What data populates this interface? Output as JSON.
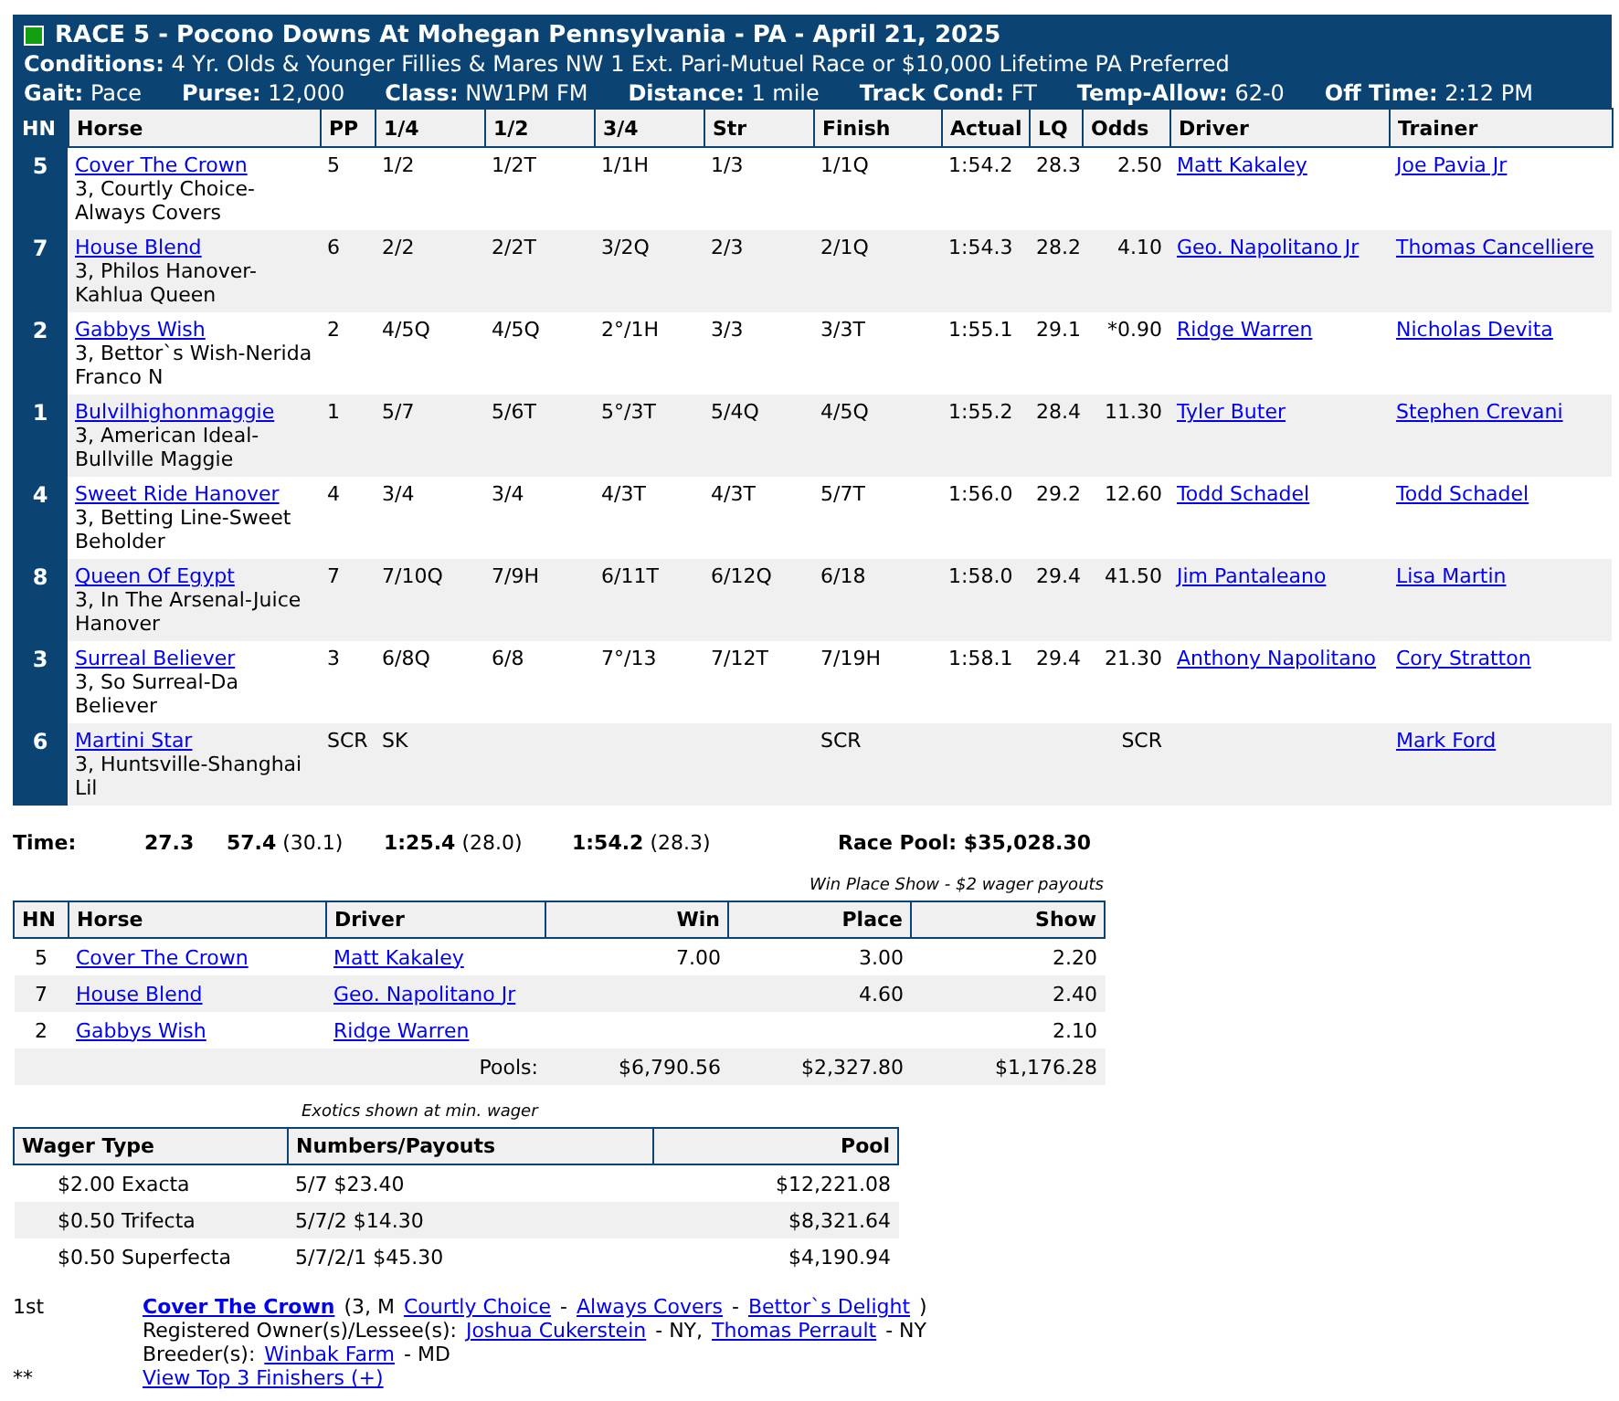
{
  "header": {
    "title": "RACE 5 - Pocono Downs At Mohegan Pennsylvania - PA - April 21, 2025",
    "conditions": {
      "label": "Conditions:",
      "value": "4 Yr. Olds & Younger Fillies & Mares NW 1 Ext. Pari-Mutuel Race or $10,000 Lifetime PA Preferred"
    },
    "info": [
      {
        "label": "Gait:",
        "value": "Pace"
      },
      {
        "label": "Purse:",
        "value": "12,000"
      },
      {
        "label": "Class:",
        "value": "NW1PM FM"
      },
      {
        "label": "Distance:",
        "value": "1 mile"
      },
      {
        "label": "Track Cond:",
        "value": "FT"
      },
      {
        "label": "Temp-Allow:",
        "value": "62-0"
      },
      {
        "label": "Off Time:",
        "value": "2:12 PM"
      }
    ]
  },
  "results": {
    "columns": [
      "HN",
      "Horse",
      "PP",
      "1/4",
      "1/2",
      "3/4",
      "Str",
      "Finish",
      "Actual",
      "LQ",
      "Odds",
      "Driver",
      "Trainer"
    ],
    "rows": [
      {
        "hn": "5",
        "horse": "Cover The Crown",
        "pedigree": "3, Courtly Choice-Always Covers",
        "pp": "5",
        "q1": "1/2",
        "q2": "1/2T",
        "q3": "1/1H",
        "str": "1/3",
        "finish": "1/1Q",
        "actual": "1:54.2",
        "lq": "28.3",
        "odds": "2.50",
        "driver": "Matt Kakaley",
        "trainer": "Joe Pavia Jr"
      },
      {
        "hn": "7",
        "horse": "House Blend",
        "pedigree": "3, Philos Hanover-Kahlua Queen",
        "pp": "6",
        "q1": "2/2",
        "q2": "2/2T",
        "q3": "3/2Q",
        "str": "2/3",
        "finish": "2/1Q",
        "actual": "1:54.3",
        "lq": "28.2",
        "odds": "4.10",
        "driver": "Geo. Napolitano Jr",
        "trainer": "Thomas Cancelliere"
      },
      {
        "hn": "2",
        "horse": "Gabbys Wish",
        "pedigree": "3, Bettor`s Wish-Nerida Franco N",
        "pp": "2",
        "q1": "4/5Q",
        "q2": "4/5Q",
        "q3": "2°/1H",
        "str": "3/3",
        "finish": "3/3T",
        "actual": "1:55.1",
        "lq": "29.1",
        "odds": "*0.90",
        "driver": "Ridge Warren",
        "trainer": "Nicholas Devita"
      },
      {
        "hn": "1",
        "horse": "Bulvilhighonmaggie",
        "pedigree": "3, American Ideal-Bullville Maggie",
        "pp": "1",
        "q1": "5/7",
        "q2": "5/6T",
        "q3": "5°/3T",
        "str": "5/4Q",
        "finish": "4/5Q",
        "actual": "1:55.2",
        "lq": "28.4",
        "odds": "11.30",
        "driver": "Tyler Buter",
        "trainer": "Stephen Crevani"
      },
      {
        "hn": "4",
        "horse": "Sweet Ride Hanover",
        "pedigree": "3, Betting Line-Sweet Beholder",
        "pp": "4",
        "q1": "3/4",
        "q2": "3/4",
        "q3": "4/3T",
        "str": "4/3T",
        "finish": "5/7T",
        "actual": "1:56.0",
        "lq": "29.2",
        "odds": "12.60",
        "driver": "Todd Schadel",
        "trainer": "Todd Schadel"
      },
      {
        "hn": "8",
        "horse": "Queen Of Egypt",
        "pedigree": "3, In The Arsenal-Juice Hanover",
        "pp": "7",
        "q1": "7/10Q",
        "q2": "7/9H",
        "q3": "6/11T",
        "str": "6/12Q",
        "finish": "6/18",
        "actual": "1:58.0",
        "lq": "29.4",
        "odds": "41.50",
        "driver": "Jim Pantaleano",
        "trainer": "Lisa Martin"
      },
      {
        "hn": "3",
        "horse": "Surreal Believer",
        "pedigree": "3, So Surreal-Da Believer",
        "pp": "3",
        "q1": "6/8Q",
        "q2": "6/8",
        "q3": "7°/13",
        "str": "7/12T",
        "finish": "7/19H",
        "actual": "1:58.1",
        "lq": "29.4",
        "odds": "21.30",
        "driver": "Anthony Napolitano",
        "trainer": "Cory Stratton"
      },
      {
        "hn": "6",
        "horse": "Martini Star",
        "pedigree": "3, Huntsville-Shanghai Lil",
        "pp": "SCR",
        "q1": "SK",
        "finish": "SCR",
        "odds": "SCR",
        "trainer": "Mark Ford"
      }
    ]
  },
  "times": {
    "label": "Time:",
    "splits": [
      "**27.3**",
      "**57.4** (30.1)",
      "**1:25.4** (28.0)",
      "**1:54.2** (28.3)"
    ]
  },
  "race_pool": "Race Pool: $35,028.30",
  "wps": {
    "caption": "Win Place Show - $2 wager payouts",
    "columns": [
      "HN",
      "Horse",
      "Driver",
      "Win",
      "Place",
      "Show"
    ],
    "rows": [
      {
        "hn": "5",
        "horse": "Cover The Crown",
        "driver": "Matt Kakaley",
        "win": "7.00",
        "place": "3.00",
        "show": "2.20"
      },
      {
        "hn": "7",
        "horse": "House Blend",
        "driver": "Geo. Napolitano Jr",
        "place": "4.60",
        "show": "2.40"
      },
      {
        "hn": "2",
        "horse": "Gabbys Wish",
        "driver": "Ridge Warren",
        "show": "2.10"
      }
    ],
    "pools": {
      "label": "Pools:",
      "win": "$6,790.56",
      "place": "$2,327.80",
      "show": "$1,176.28"
    }
  },
  "exotics": {
    "caption": "Exotics shown at min. wager",
    "columns": [
      "Wager Type",
      "Numbers/Payouts",
      "Pool"
    ],
    "rows": [
      {
        "wager": "$2.00 Exacta",
        "numbers": "5/7 $23.40",
        "pool": "$12,221.08"
      },
      {
        "wager": "$0.50 Trifecta",
        "numbers": "5/7/2 $14.30",
        "pool": "$8,321.64"
      },
      {
        "wager": "$0.50 Superfecta",
        "numbers": "5/7/2/1 $45.30",
        "pool": "$4,190.94"
      }
    ]
  },
  "winner": {
    "lines": [
      {
        "mark": "1st",
        "parts": [
          {
            "kind": "bold-link",
            "text": "Cover The Crown"
          },
          {
            "kind": "text",
            "text": "(3, M"
          },
          {
            "kind": "link",
            "text": "Courtly Choice"
          },
          {
            "kind": "text",
            "text": "-"
          },
          {
            "kind": "link",
            "text": "Always Covers"
          },
          {
            "kind": "text",
            "text": "-"
          },
          {
            "kind": "link",
            "text": "Bettor`s Delight"
          },
          {
            "kind": "text",
            "text": ")"
          }
        ]
      },
      {
        "parts": [
          {
            "kind": "text",
            "text": "Registered Owner(s)/Lessee(s):"
          },
          {
            "kind": "link",
            "text": "Joshua Cukerstein"
          },
          {
            "kind": "text",
            "text": "- NY,"
          },
          {
            "kind": "link",
            "text": "Thomas Perrault"
          },
          {
            "kind": "text",
            "text": "- NY"
          }
        ]
      },
      {
        "parts": [
          {
            "kind": "text",
            "text": "Breeder(s):"
          },
          {
            "kind": "link",
            "text": "Winbak Farm"
          },
          {
            "kind": "text",
            "text": "- MD"
          }
        ]
      },
      {
        "mark": "**",
        "parts": [
          {
            "kind": "link",
            "text": "View Top 3 Finishers (+)"
          }
        ]
      }
    ]
  }
}
